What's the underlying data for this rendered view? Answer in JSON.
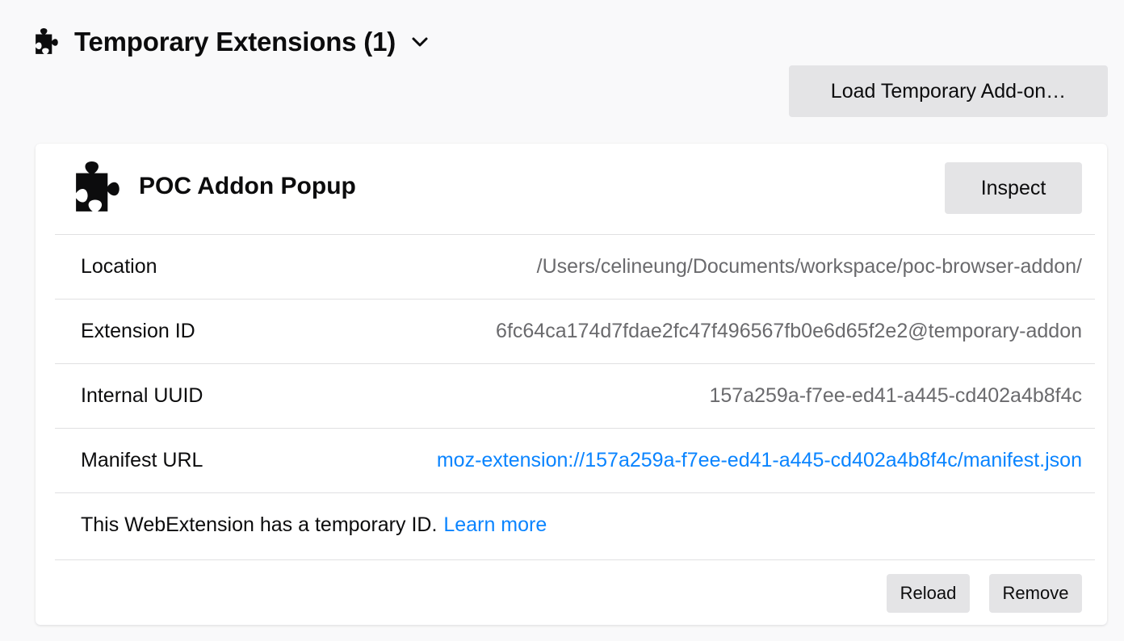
{
  "section": {
    "icon": "puzzle-piece-icon",
    "title": "Temporary Extensions (1)",
    "toggle_icon": "chevron-down-icon"
  },
  "actions": {
    "load_temporary_label": "Load Temporary Add-on…"
  },
  "extension": {
    "icon": "puzzle-piece-icon",
    "name": "POC Addon Popup",
    "inspect_label": "Inspect",
    "fields": {
      "location": {
        "label": "Location",
        "value": "/Users/celineung/Documents/workspace/poc-browser-addon/"
      },
      "extension_id": {
        "label": "Extension ID",
        "value": "6fc64ca174d7fdae2fc47f496567fb0e6d65f2e2@temporary-addon"
      },
      "internal_uuid": {
        "label": "Internal UUID",
        "value": "157a259a-f7ee-ed41-a445-cd402a4b8f4c"
      },
      "manifest_url": {
        "label": "Manifest URL",
        "value": "moz-extension://157a259a-f7ee-ed41-a445-cd402a4b8f4c/manifest.json"
      }
    },
    "temporary_notice": "This WebExtension has a temporary ID.",
    "learn_more_label": "Learn more",
    "reload_label": "Reload",
    "remove_label": "Remove"
  },
  "colors": {
    "link": "#0a84ff",
    "button_bg": "#e4e4e6",
    "page_bg": "#f9f9fa"
  }
}
